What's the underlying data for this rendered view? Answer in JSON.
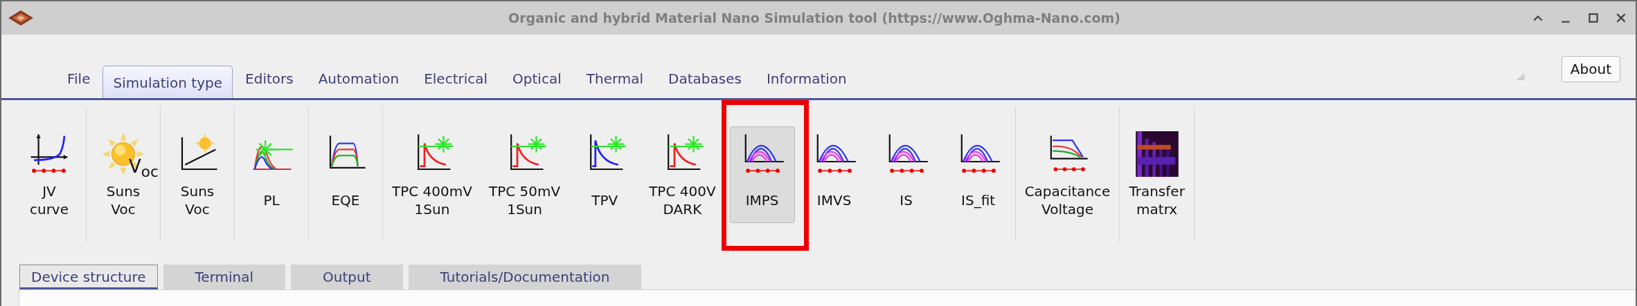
{
  "window": {
    "title": "Organic and hybrid Material Nano Simulation tool (https://www.Oghma-Nano.com)"
  },
  "menu_tabs": [
    {
      "label": "File",
      "selected": false
    },
    {
      "label": "Simulation type",
      "selected": true
    },
    {
      "label": "Editors",
      "selected": false
    },
    {
      "label": "Automation",
      "selected": false
    },
    {
      "label": "Electrical",
      "selected": false
    },
    {
      "label": "Optical",
      "selected": false
    },
    {
      "label": "Thermal",
      "selected": false
    },
    {
      "label": "Databases",
      "selected": false
    },
    {
      "label": "Information",
      "selected": false
    }
  ],
  "about_button": "About",
  "toolbar": {
    "groups": [
      {
        "items": [
          {
            "label": "JV\ncurve",
            "kind": "jv",
            "selected": false,
            "highlighted": false
          }
        ]
      },
      {
        "items": [
          {
            "label": "Suns\nVoc",
            "kind": "sun",
            "icon_text": "V$_{oc}$",
            "selected": false,
            "highlighted": false
          }
        ]
      },
      {
        "items": [
          {
            "label": "Suns\nVoc",
            "kind": "sunsvoc",
            "selected": false,
            "highlighted": false
          }
        ]
      },
      {
        "items": [
          {
            "label": "PL",
            "kind": "pl",
            "selected": false,
            "highlighted": false
          }
        ]
      },
      {
        "items": [
          {
            "label": "EQE",
            "kind": "eqe",
            "selected": false,
            "highlighted": false
          }
        ]
      },
      {
        "items": [
          {
            "label": "TPC 400mV\n1Sun",
            "kind": "tpc",
            "selected": false,
            "highlighted": false
          },
          {
            "label": "TPC 50mV\n1Sun",
            "kind": "tpc",
            "selected": false,
            "highlighted": false
          },
          {
            "label": "TPV",
            "kind": "tpv",
            "selected": false,
            "highlighted": false
          },
          {
            "label": "TPC 400V\nDARK",
            "kind": "tpc",
            "selected": false,
            "highlighted": false
          }
        ]
      },
      {
        "items": [
          {
            "label": "IMPS",
            "kind": "imps",
            "selected": true,
            "highlighted": true
          },
          {
            "label": "IMVS",
            "kind": "imps",
            "selected": false,
            "highlighted": false
          },
          {
            "label": "IS",
            "kind": "imps",
            "selected": false,
            "highlighted": false
          },
          {
            "label": "IS_fit",
            "kind": "imps",
            "selected": false,
            "highlighted": false
          }
        ]
      },
      {
        "items": [
          {
            "label": "Capacitance\nVoltage",
            "kind": "cv",
            "selected": false,
            "highlighted": false
          }
        ]
      },
      {
        "items": [
          {
            "label": "Transfer\nmatrx",
            "kind": "heatmap",
            "selected": false,
            "highlighted": false
          }
        ]
      }
    ]
  },
  "bottom_tabs": [
    {
      "label": "Device structure",
      "selected": true
    },
    {
      "label": "Terminal",
      "selected": false
    },
    {
      "label": "Output",
      "selected": false
    },
    {
      "label": "Tutorials/Documentation",
      "selected": false
    }
  ]
}
